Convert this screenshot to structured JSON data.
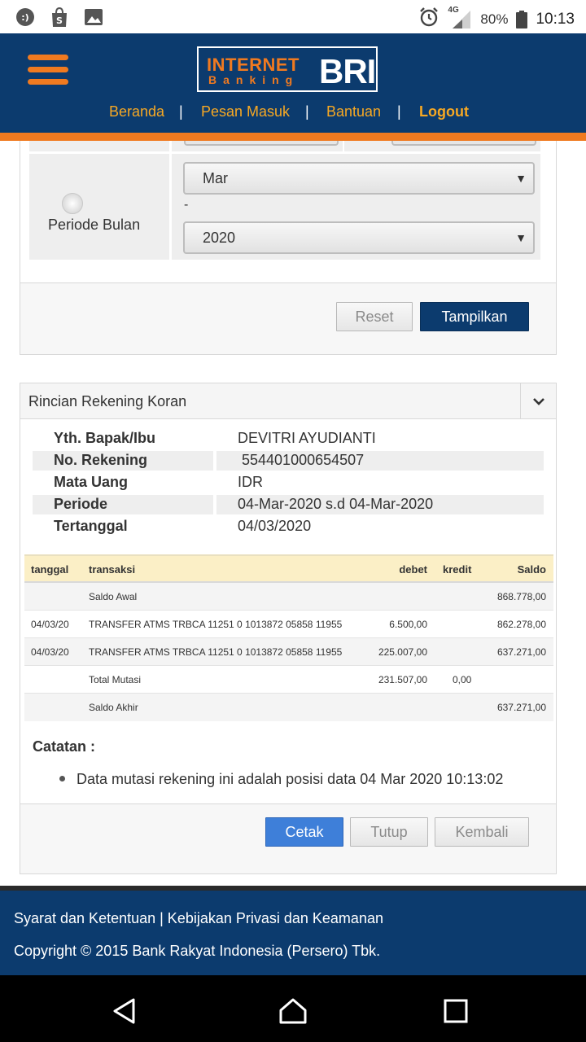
{
  "status_bar": {
    "left_icons": [
      "messenger-icon",
      "shopee-bag-icon",
      "image-icon"
    ],
    "network": "4G",
    "battery": "80%",
    "time": "10:13",
    "colors": {
      "background": "#ffffff",
      "text": "#333333"
    }
  },
  "header": {
    "logo": {
      "line1": "INTERNET",
      "line2": "Banking",
      "brand": "BRI"
    },
    "nav": {
      "home": "Beranda",
      "inbox": "Pesan Masuk",
      "help": "Bantuan",
      "logout": "Logout",
      "separator": "|"
    },
    "colors": {
      "background": "#0c3b6e",
      "accent": "#f07a20",
      "nav_text": "#f7a823"
    }
  },
  "filter_form": {
    "period_month_label": "Periode Bulan",
    "month_value": "Mar",
    "range_separator": "-",
    "year_value": "2020",
    "reset_label": "Reset",
    "submit_label": "Tampilkan"
  },
  "statement": {
    "title": "Rincian Rekening Koran",
    "info": [
      {
        "label": "Yth. Bapak/Ibu",
        "value": "DEVITRI AYUDIANTI"
      },
      {
        "label": "No. Rekening",
        "value": "554401000654507"
      },
      {
        "label": "Mata Uang",
        "value": "IDR"
      },
      {
        "label": "Periode",
        "value": "04-Mar-2020 s.d 04-Mar-2020"
      },
      {
        "label": "Tertanggal",
        "value": "04/03/2020"
      }
    ],
    "table": {
      "headers": {
        "date": "tanggal",
        "transaction": "transaksi",
        "debit": "debet",
        "credit": "kredit",
        "balance": "Saldo"
      },
      "rows": [
        {
          "date": "",
          "transaction": "Saldo Awal",
          "debit": "",
          "credit": "",
          "balance": "868.778,00"
        },
        {
          "date": "04/03/20",
          "transaction": "TRANSFER ATMS TRBCA 11251 0 1013872 05858 11955",
          "debit": "6.500,00",
          "credit": "",
          "balance": "862.278,00"
        },
        {
          "date": "04/03/20",
          "transaction": "TRANSFER ATMS TRBCA 11251 0 1013872 05858 11955",
          "debit": "225.007,00",
          "credit": "",
          "balance": "637.271,00"
        },
        {
          "date": "",
          "transaction": "Total Mutasi",
          "debit": "231.507,00",
          "credit": "0,00",
          "balance": ""
        },
        {
          "date": "",
          "transaction": "Saldo Akhir",
          "debit": "",
          "credit": "",
          "balance": "637.271,00"
        }
      ]
    },
    "notes_title": "Catatan :",
    "notes": [
      "Data mutasi rekening ini adalah posisi data 04 Mar 2020 10:13:02"
    ],
    "actions": {
      "print": "Cetak",
      "close": "Tutup",
      "back": "Kembali"
    }
  },
  "footer": {
    "links": "Syarat dan Ketentuan | Kebijakan Privasi dan Keamanan",
    "copyright": "Copyright © 2015 Bank Rakyat Indonesia (Persero) Tbk."
  },
  "system_nav": {
    "icons": [
      "back-icon",
      "home-icon",
      "recents-icon"
    ]
  }
}
